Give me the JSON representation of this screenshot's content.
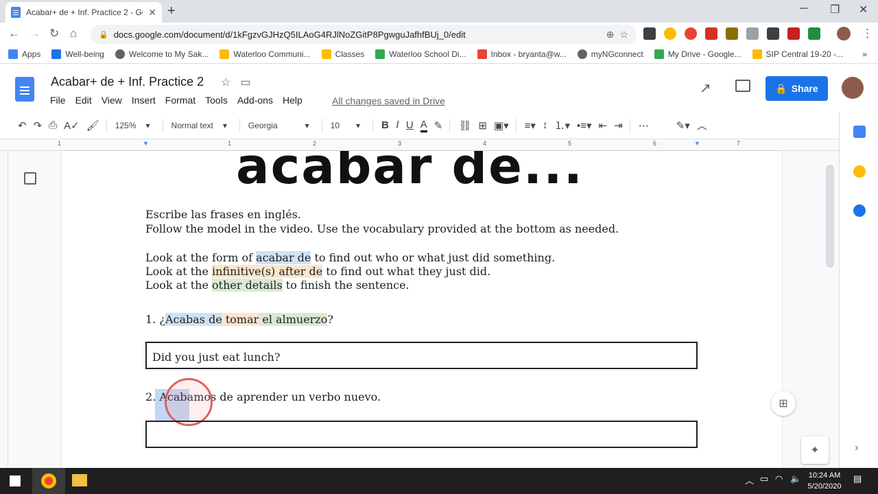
{
  "browser": {
    "tab_title": "Acabar+ de + Inf. Practice 2 - Go",
    "url": "docs.google.com/document/d/1kFgzvGJHzQ5ILAoG4RJlNoZGitP8PgwguJafhfBUj_0/edit",
    "bookmarks": [
      "Apps",
      "Well-being",
      "Welcome to My Sak...",
      "Waterloo Communi...",
      "Classes",
      "Waterloo School Di...",
      "Inbox - bryanta@w...",
      "myNGconnect",
      "My Drive - Google...",
      "SIP Central 19-20 -..."
    ],
    "bookmark_colors": [
      "#4285f4",
      "#1a73e8",
      "#5f6368",
      "#fbbc04",
      "#fbbc04",
      "#34a853",
      "#ea4335",
      "#5f6368",
      "#34a853",
      "#fbbc04"
    ]
  },
  "docs": {
    "title": "Acabar+ de + Inf. Practice 2",
    "menu": [
      "File",
      "Edit",
      "View",
      "Insert",
      "Format",
      "Tools",
      "Add-ons",
      "Help"
    ],
    "save_status": "All changes saved in Drive",
    "share_label": "Share",
    "zoom": "125%",
    "style": "Normal text",
    "font": "Georgia",
    "font_size": "10",
    "ruler_numbers": [
      "1",
      "1",
      "2",
      "3",
      "4",
      "5",
      "6",
      "7"
    ]
  },
  "document": {
    "big_title": "acabar de...",
    "instr1": "Escribe las frases en inglés.",
    "instr2": "Follow the model in the video.  Use the vocabulary provided at the bottom as needed.",
    "look1_pre": "Look at the form of ",
    "look1_hl": "acabar de",
    "look1_post": " to find out who or what just did something.",
    "look2_pre": "Look at the ",
    "look2_hl": "infinitive(s) after de",
    "look2_post": " to find out what they just did.",
    "look3_pre": "Look at the ",
    "look3_hl": "other details",
    "look3_post": " to finish the sentence.",
    "q1_num": "1. ¿",
    "q1_a": "Acabas de",
    "q1_b": " tomar",
    "q1_c": " el almuerzo",
    "q1_end": "?",
    "a1": "Did you just eat lunch?",
    "q2": "2. Acabamos de aprender un verbo nuevo.",
    "a2": ""
  },
  "taskbar": {
    "time": "10:24 AM",
    "date": "5/20/2020"
  },
  "colors": {
    "share_blue": "#1a73e8",
    "hl_blue": "#cfe2f3",
    "hl_orange": "#fce5cd",
    "hl_green": "#d9ead3"
  }
}
